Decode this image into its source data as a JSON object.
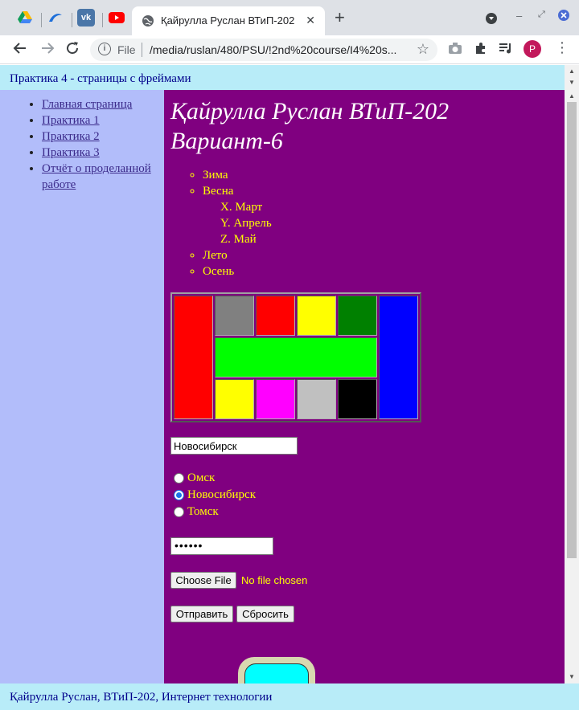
{
  "browser": {
    "tab_title": "Қайрулла Руслан ВТиП-202",
    "address_scheme": "File",
    "address_url": "/media/ruslan/480/PSU/!2nd%20course/I4%20s...",
    "profile_initial": "P"
  },
  "top_frame": {
    "text": "Практика 4 - страницы с фреймами"
  },
  "left_frame": {
    "links": [
      "Главная страница",
      "Практика 1",
      "Практика 2",
      "Практика 3",
      "Отчёт о проделанной работе"
    ]
  },
  "main": {
    "heading_line1": "Қайрулла Руслан ВТиП-202",
    "heading_line2": "Вариант-6",
    "seasons": {
      "winter": "Зима",
      "spring": "Весна",
      "spring_months": [
        "X. Март",
        "Y. Апрель",
        "Z. Май"
      ],
      "summer": "Лето",
      "autumn": "Осень"
    },
    "color_table": {
      "colors": [
        "#ff0000",
        "#808080",
        "#ff0000",
        "#ffff00",
        "#008000",
        "#0000ff",
        "#00ff00",
        "#ffff00",
        "#ff00ff",
        "#c0c0c0",
        "#000000"
      ]
    },
    "city_input_value": "Новосибирск",
    "radio_options": [
      "Омск",
      "Новосибирск",
      "Томск"
    ],
    "radio_selected": "Новосибирск",
    "password_value": "••••••",
    "file_button": "Choose File",
    "file_status": "No file chosen",
    "submit_label": "Отправить",
    "reset_label": "Сбросить"
  },
  "bottom_frame": {
    "text": "Қайрулла Руслан, ВТиП-202, Интернет технологии"
  },
  "colors": {
    "main_bg": "#800080",
    "left_bg": "#b2bdfa",
    "frame_bg": "#b8ecf8",
    "text_yellow": "#ffff00"
  }
}
